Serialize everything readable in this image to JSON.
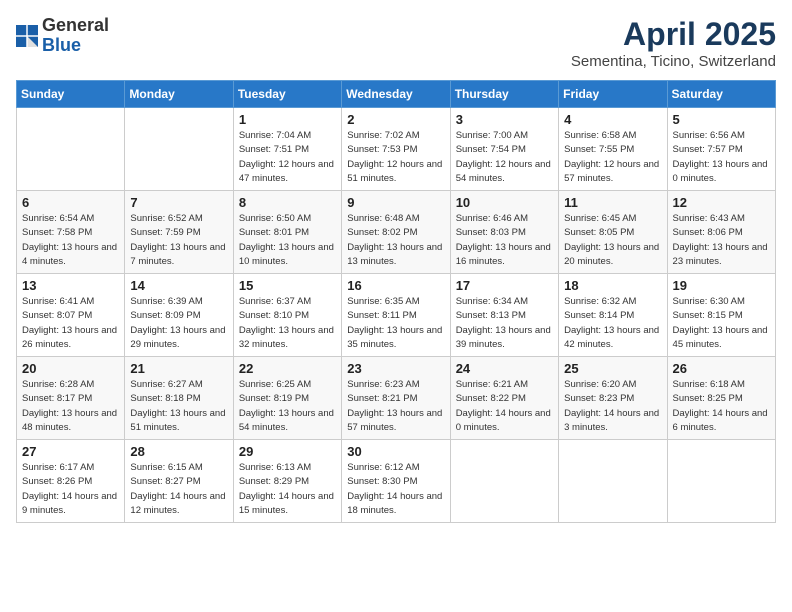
{
  "header": {
    "logo_general": "General",
    "logo_blue": "Blue",
    "title": "April 2025",
    "subtitle": "Sementina, Ticino, Switzerland"
  },
  "weekdays": [
    "Sunday",
    "Monday",
    "Tuesday",
    "Wednesday",
    "Thursday",
    "Friday",
    "Saturday"
  ],
  "weeks": [
    [
      {
        "day": null,
        "info": null
      },
      {
        "day": null,
        "info": null
      },
      {
        "day": "1",
        "info": "Sunrise: 7:04 AM\nSunset: 7:51 PM\nDaylight: 12 hours and 47 minutes."
      },
      {
        "day": "2",
        "info": "Sunrise: 7:02 AM\nSunset: 7:53 PM\nDaylight: 12 hours and 51 minutes."
      },
      {
        "day": "3",
        "info": "Sunrise: 7:00 AM\nSunset: 7:54 PM\nDaylight: 12 hours and 54 minutes."
      },
      {
        "day": "4",
        "info": "Sunrise: 6:58 AM\nSunset: 7:55 PM\nDaylight: 12 hours and 57 minutes."
      },
      {
        "day": "5",
        "info": "Sunrise: 6:56 AM\nSunset: 7:57 PM\nDaylight: 13 hours and 0 minutes."
      }
    ],
    [
      {
        "day": "6",
        "info": "Sunrise: 6:54 AM\nSunset: 7:58 PM\nDaylight: 13 hours and 4 minutes."
      },
      {
        "day": "7",
        "info": "Sunrise: 6:52 AM\nSunset: 7:59 PM\nDaylight: 13 hours and 7 minutes."
      },
      {
        "day": "8",
        "info": "Sunrise: 6:50 AM\nSunset: 8:01 PM\nDaylight: 13 hours and 10 minutes."
      },
      {
        "day": "9",
        "info": "Sunrise: 6:48 AM\nSunset: 8:02 PM\nDaylight: 13 hours and 13 minutes."
      },
      {
        "day": "10",
        "info": "Sunrise: 6:46 AM\nSunset: 8:03 PM\nDaylight: 13 hours and 16 minutes."
      },
      {
        "day": "11",
        "info": "Sunrise: 6:45 AM\nSunset: 8:05 PM\nDaylight: 13 hours and 20 minutes."
      },
      {
        "day": "12",
        "info": "Sunrise: 6:43 AM\nSunset: 8:06 PM\nDaylight: 13 hours and 23 minutes."
      }
    ],
    [
      {
        "day": "13",
        "info": "Sunrise: 6:41 AM\nSunset: 8:07 PM\nDaylight: 13 hours and 26 minutes."
      },
      {
        "day": "14",
        "info": "Sunrise: 6:39 AM\nSunset: 8:09 PM\nDaylight: 13 hours and 29 minutes."
      },
      {
        "day": "15",
        "info": "Sunrise: 6:37 AM\nSunset: 8:10 PM\nDaylight: 13 hours and 32 minutes."
      },
      {
        "day": "16",
        "info": "Sunrise: 6:35 AM\nSunset: 8:11 PM\nDaylight: 13 hours and 35 minutes."
      },
      {
        "day": "17",
        "info": "Sunrise: 6:34 AM\nSunset: 8:13 PM\nDaylight: 13 hours and 39 minutes."
      },
      {
        "day": "18",
        "info": "Sunrise: 6:32 AM\nSunset: 8:14 PM\nDaylight: 13 hours and 42 minutes."
      },
      {
        "day": "19",
        "info": "Sunrise: 6:30 AM\nSunset: 8:15 PM\nDaylight: 13 hours and 45 minutes."
      }
    ],
    [
      {
        "day": "20",
        "info": "Sunrise: 6:28 AM\nSunset: 8:17 PM\nDaylight: 13 hours and 48 minutes."
      },
      {
        "day": "21",
        "info": "Sunrise: 6:27 AM\nSunset: 8:18 PM\nDaylight: 13 hours and 51 minutes."
      },
      {
        "day": "22",
        "info": "Sunrise: 6:25 AM\nSunset: 8:19 PM\nDaylight: 13 hours and 54 minutes."
      },
      {
        "day": "23",
        "info": "Sunrise: 6:23 AM\nSunset: 8:21 PM\nDaylight: 13 hours and 57 minutes."
      },
      {
        "day": "24",
        "info": "Sunrise: 6:21 AM\nSunset: 8:22 PM\nDaylight: 14 hours and 0 minutes."
      },
      {
        "day": "25",
        "info": "Sunrise: 6:20 AM\nSunset: 8:23 PM\nDaylight: 14 hours and 3 minutes."
      },
      {
        "day": "26",
        "info": "Sunrise: 6:18 AM\nSunset: 8:25 PM\nDaylight: 14 hours and 6 minutes."
      }
    ],
    [
      {
        "day": "27",
        "info": "Sunrise: 6:17 AM\nSunset: 8:26 PM\nDaylight: 14 hours and 9 minutes."
      },
      {
        "day": "28",
        "info": "Sunrise: 6:15 AM\nSunset: 8:27 PM\nDaylight: 14 hours and 12 minutes."
      },
      {
        "day": "29",
        "info": "Sunrise: 6:13 AM\nSunset: 8:29 PM\nDaylight: 14 hours and 15 minutes."
      },
      {
        "day": "30",
        "info": "Sunrise: 6:12 AM\nSunset: 8:30 PM\nDaylight: 14 hours and 18 minutes."
      },
      {
        "day": null,
        "info": null
      },
      {
        "day": null,
        "info": null
      },
      {
        "day": null,
        "info": null
      }
    ]
  ]
}
